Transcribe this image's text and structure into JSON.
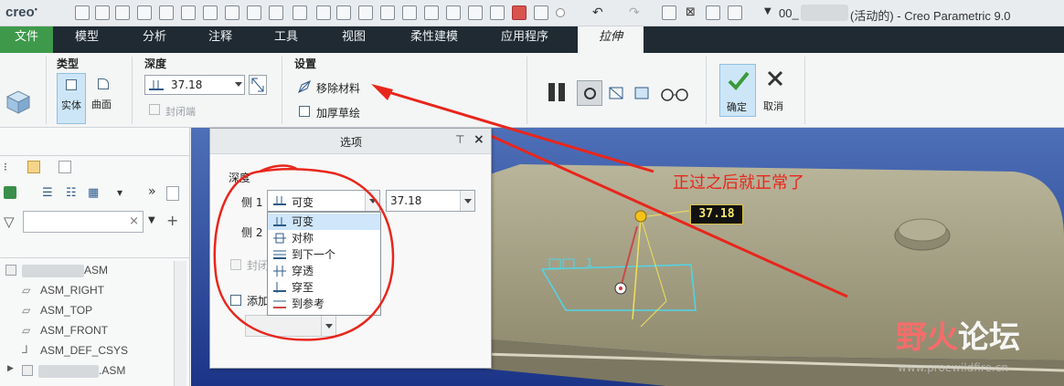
{
  "app": {
    "logo": "creo",
    "window_title": "(活动的) - Creo Parametric 9.0",
    "file_prefix": "00_"
  },
  "tabs": [
    "文件",
    "模型",
    "分析",
    "注释",
    "工具",
    "视图",
    "柔性建模",
    "应用程序",
    "拉伸"
  ],
  "ribbon": {
    "type_group": {
      "label": "类型",
      "solid": "实体",
      "surface": "曲面"
    },
    "depth_group": {
      "label": "深度",
      "value": "37.18",
      "closed_ends": "封闭端"
    },
    "settings_group": {
      "label": "设置",
      "remove_material": "移除材料",
      "thicken_sketch": "加厚草绘"
    },
    "ok": "确定",
    "cancel": "取消"
  },
  "left_panel": {
    "tree": [
      "ASM",
      "ASM_RIGHT",
      "ASM_TOP",
      "ASM_FRONT",
      "ASM_DEF_CSYS",
      ".ASM"
    ]
  },
  "options_popup": {
    "title": "选项",
    "depth_label": "深度",
    "side1_label": "侧 1",
    "side2_label": "侧 2",
    "side1_selected": "可变",
    "side1_value": "37.18",
    "closed_ends": "封闭",
    "add_taper": "添加",
    "dropdown_items": [
      "可变",
      "对称",
      "到下一个",
      "穿透",
      "穿至",
      "到参考"
    ]
  },
  "annotation": {
    "note": "正过之后就正常了",
    "dimension": "37.18",
    "sketch_label": "1"
  },
  "watermark": {
    "text_a": "野火",
    "text_b": "论坛",
    "url": "www.proewildfire.cn"
  },
  "colors": {
    "file_tab": "#3e9a4a",
    "tab_bar": "#1f2a33",
    "viewport": "#1e3a8c",
    "annotation_red": "#e8261c",
    "sketch_cyan": "#4fd6e8"
  }
}
